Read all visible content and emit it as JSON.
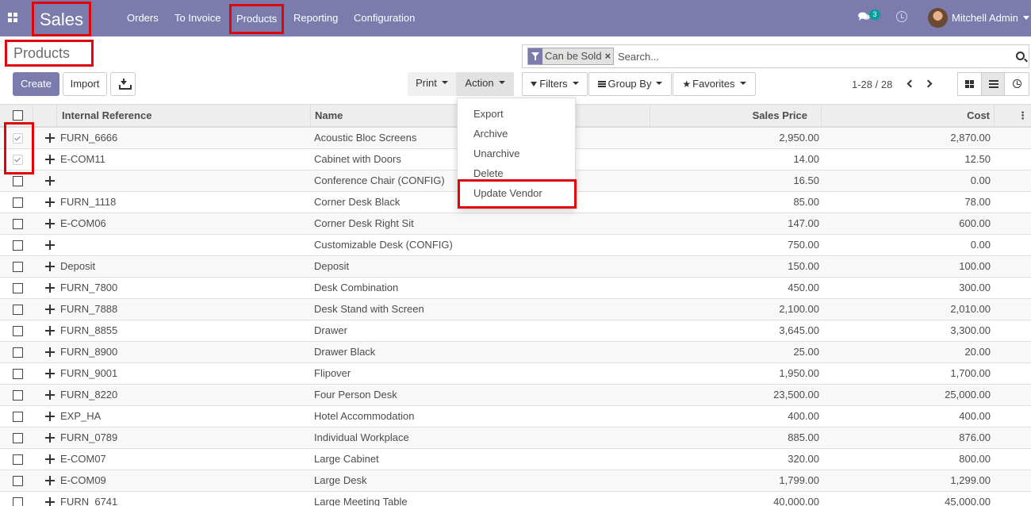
{
  "navbar": {
    "app_title": "Sales",
    "menu": [
      "Orders",
      "To Invoice",
      "Products",
      "Reporting",
      "Configuration"
    ],
    "chat_count": "3",
    "user_name": "Mitchell Admin"
  },
  "page_title": "Products",
  "search": {
    "facet_label": "Can be Sold",
    "facet_close": "×",
    "placeholder": "Search..."
  },
  "buttons": {
    "create": "Create",
    "import": "Import",
    "print": "Print",
    "action": "Action",
    "filters": "Filters",
    "group_by": "Group By",
    "favorites": "Favorites"
  },
  "pager": {
    "value": "1-28 / 28"
  },
  "action_menu": [
    "Export",
    "Archive",
    "Unarchive",
    "Delete",
    "Update Vendor"
  ],
  "table": {
    "columns": [
      "Internal Reference",
      "Name",
      "Sales Price",
      "Cost"
    ],
    "rows": [
      {
        "ref": "FURN_6666",
        "name": "Acoustic Bloc Screens",
        "price": "2,950.00",
        "cost": "2,870.00",
        "checked": true
      },
      {
        "ref": "E-COM11",
        "name": "Cabinet with Doors",
        "price": "14.00",
        "cost": "12.50",
        "checked": true
      },
      {
        "ref": "",
        "name": "Conference Chair (CONFIG)",
        "price": "16.50",
        "cost": "0.00",
        "checked": false
      },
      {
        "ref": "FURN_1118",
        "name": "Corner Desk Black",
        "price": "85.00",
        "cost": "78.00",
        "checked": false
      },
      {
        "ref": "E-COM06",
        "name": "Corner Desk Right Sit",
        "price": "147.00",
        "cost": "600.00",
        "checked": false
      },
      {
        "ref": "",
        "name": "Customizable Desk (CONFIG)",
        "price": "750.00",
        "cost": "0.00",
        "checked": false
      },
      {
        "ref": "Deposit",
        "name": "Deposit",
        "price": "150.00",
        "cost": "100.00",
        "checked": false
      },
      {
        "ref": "FURN_7800",
        "name": "Desk Combination",
        "price": "450.00",
        "cost": "300.00",
        "checked": false
      },
      {
        "ref": "FURN_7888",
        "name": "Desk Stand with Screen",
        "price": "2,100.00",
        "cost": "2,010.00",
        "checked": false
      },
      {
        "ref": "FURN_8855",
        "name": "Drawer",
        "price": "3,645.00",
        "cost": "3,300.00",
        "checked": false
      },
      {
        "ref": "FURN_8900",
        "name": "Drawer Black",
        "price": "25.00",
        "cost": "20.00",
        "checked": false
      },
      {
        "ref": "FURN_9001",
        "name": "Flipover",
        "price": "1,950.00",
        "cost": "1,700.00",
        "checked": false
      },
      {
        "ref": "FURN_8220",
        "name": "Four Person Desk",
        "price": "23,500.00",
        "cost": "25,000.00",
        "checked": false
      },
      {
        "ref": "EXP_HA",
        "name": "Hotel Accommodation",
        "price": "400.00",
        "cost": "400.00",
        "checked": false
      },
      {
        "ref": "FURN_0789",
        "name": "Individual Workplace",
        "price": "885.00",
        "cost": "876.00",
        "checked": false
      },
      {
        "ref": "E-COM07",
        "name": "Large Cabinet",
        "price": "320.00",
        "cost": "800.00",
        "checked": false
      },
      {
        "ref": "E-COM09",
        "name": "Large Desk",
        "price": "1,799.00",
        "cost": "1,299.00",
        "checked": false
      },
      {
        "ref": "FURN_6741",
        "name": "Large Meeting Table",
        "price": "40,000.00",
        "cost": "45,000.00",
        "checked": false
      }
    ]
  }
}
